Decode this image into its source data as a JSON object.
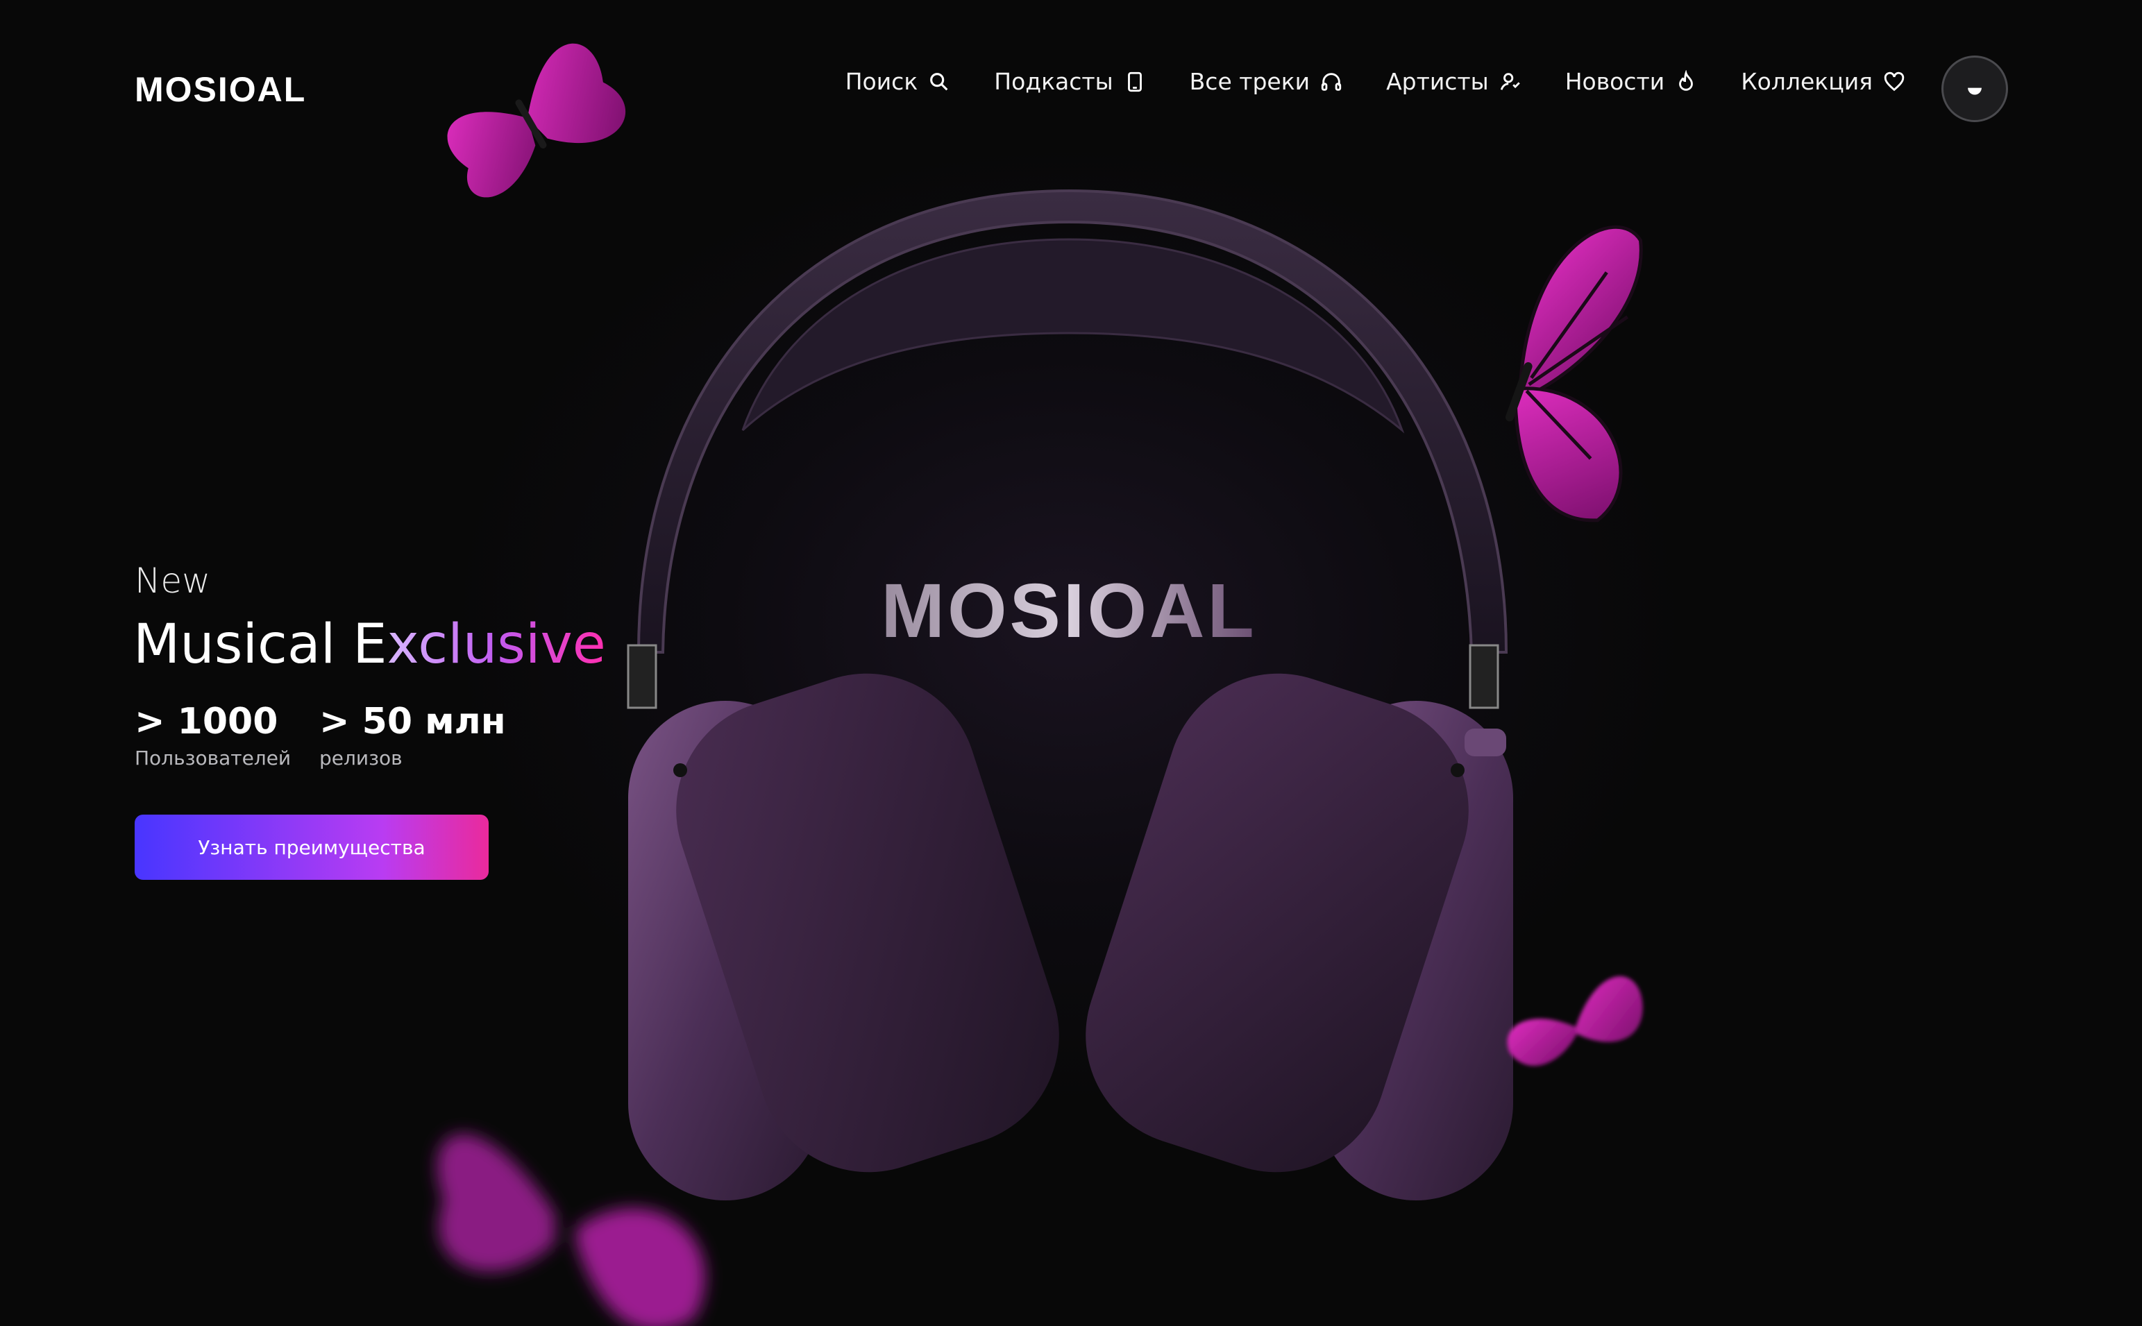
{
  "brand": {
    "logo": "MOSIOAL",
    "headphone_logo": "MOSIOAL"
  },
  "nav": {
    "items": [
      {
        "label": "Поиск",
        "icon": "search-icon"
      },
      {
        "label": "Подкасты",
        "icon": "tablet-icon"
      },
      {
        "label": "Все треки",
        "icon": "headphones-icon"
      },
      {
        "label": "Артисты",
        "icon": "artists-icon"
      },
      {
        "label": "Новости",
        "icon": "flame-icon"
      },
      {
        "label": "Коллекция",
        "icon": "heart-icon"
      }
    ],
    "avatar_icon": "moon-icon"
  },
  "hero": {
    "kicker": "New",
    "title_plain": "Musical E",
    "title_gradient": "xclusive",
    "stats": [
      {
        "value": "> 1000",
        "label": "Пользователей"
      },
      {
        "value": "> 50 млн",
        "label": "релизов"
      }
    ],
    "cta_label": "Узнать преимущества"
  },
  "colors": {
    "background": "#0a0a0b",
    "accent_start": "#4836ff",
    "accent_mid": "#b93cf2",
    "accent_end": "#ea2a9c",
    "headphone_purple": "#5a3a66",
    "butterfly_magenta": "#c21aa8"
  }
}
